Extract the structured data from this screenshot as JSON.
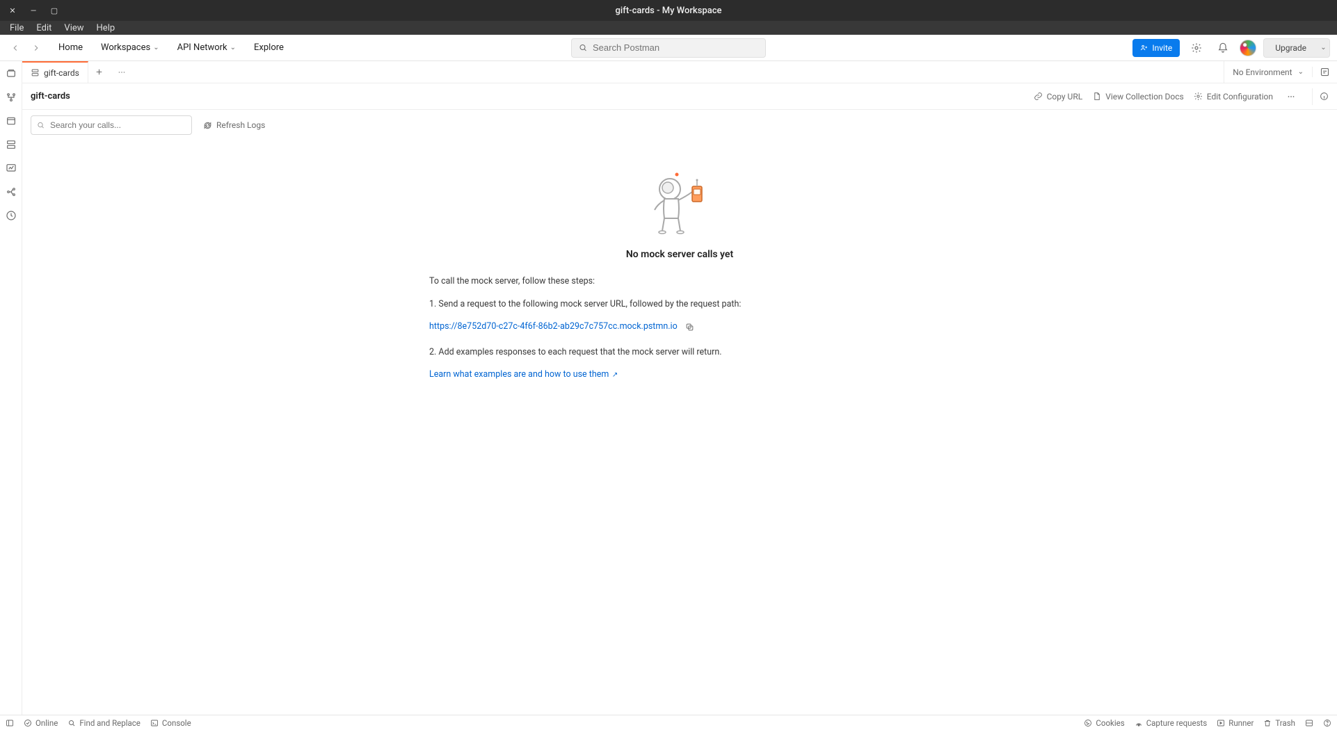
{
  "window": {
    "title": "gift-cards - My Workspace"
  },
  "menubar": {
    "file": "File",
    "edit": "Edit",
    "view": "View",
    "help": "Help"
  },
  "topnav": {
    "home": "Home",
    "workspaces": "Workspaces",
    "api_network": "API Network",
    "explore": "Explore",
    "search_placeholder": "Search Postman",
    "invite": "Invite",
    "upgrade": "Upgrade"
  },
  "tab": {
    "name": "gift-cards"
  },
  "env": {
    "selected": "No Environment"
  },
  "header": {
    "title": "gift-cards",
    "copy_url": "Copy URL",
    "view_docs": "View Collection Docs",
    "edit_config": "Edit Configuration"
  },
  "filter": {
    "search_placeholder": "Search your calls...",
    "refresh": "Refresh Logs"
  },
  "empty": {
    "title": "No mock server calls yet",
    "intro": "To call the mock server, follow these steps:",
    "step1": "1. Send a request to the following mock server URL, followed by the request path:",
    "url": "https://8e752d70-c27c-4f6f-86b2-ab29c7c757cc.mock.pstmn.io",
    "step2": "2. Add examples responses to each request that the mock server will return.",
    "learn": "Learn what examples are and how to use them"
  },
  "statusbar": {
    "online": "Online",
    "find": "Find and Replace",
    "console": "Console",
    "cookies": "Cookies",
    "capture": "Capture requests",
    "runner": "Runner",
    "trash": "Trash"
  }
}
